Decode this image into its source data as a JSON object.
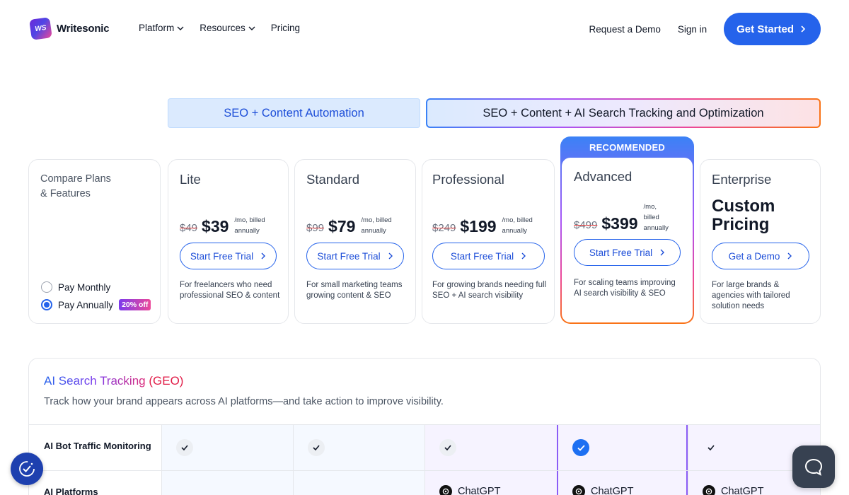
{
  "header": {
    "logo_mark": "WS",
    "logo_text": "Writesonic",
    "nav": [
      {
        "label": "Platform"
      },
      {
        "label": "Resources"
      },
      {
        "label": "Pricing"
      }
    ],
    "request_demo": "Request a Demo",
    "sign_in": "Sign in",
    "get_started": "Get Started"
  },
  "tabs": {
    "tab1": "SEO + Content Automation",
    "tab2": "SEO + Content + AI Search Tracking and Optimization"
  },
  "compare": {
    "title_line1": "Compare Plans",
    "title_line2": "& Features",
    "pay_monthly": "Pay Monthly",
    "pay_annually": "Pay Annually",
    "discount_badge": "20% off",
    "selected": "annually"
  },
  "plans": [
    {
      "name": "Lite",
      "old_price": "$49",
      "price": "$39",
      "per_line1": "/mo, billed",
      "per_line2": "annually",
      "cta": "Start Free Trial",
      "desc_line1": "For freelancers who need",
      "desc_line2": "professional SEO & content"
    },
    {
      "name": "Standard",
      "old_price": "$99",
      "price": "$79",
      "per_line1": "/mo, billed",
      "per_line2": "annually",
      "cta": "Start Free Trial",
      "desc_line1": "For small marketing teams",
      "desc_line2": "growing content & SEO"
    },
    {
      "name": "Professional",
      "old_price": "$249",
      "price": "$199",
      "per_line1": "/mo, billed",
      "per_line2": "annually",
      "cta": "Start Free Trial",
      "desc_line1": "For growing brands needing full",
      "desc_line2": "SEO + AI search visibility"
    },
    {
      "name": "Advanced",
      "badge": "RECOMMENDED",
      "old_price": "$499",
      "price": "$399",
      "per_line1": "/mo,",
      "per_line2": "billed",
      "per_line3": "annually",
      "cta": "Start Free Trial",
      "desc_line1": "For scaling teams improving",
      "desc_line2": "AI search visibility & SEO"
    },
    {
      "name": "Enterprise",
      "big_line1": "Custom",
      "big_line2": "Pricing",
      "cta": "Get a Demo",
      "desc_line1": "For large brands &",
      "desc_line2": "agencies with tailored",
      "desc_line3": "solution needs"
    }
  ],
  "geo": {
    "title_main": "AI Search Tracking",
    "title_tag": "(GEO)",
    "subtitle": "Track how your brand appears across AI platforms—and take action to improve visibility.",
    "rows": [
      {
        "label": "AI Bot Traffic Monitoring",
        "values": [
          "check",
          "check",
          "check",
          "check-blue",
          "check"
        ]
      },
      {
        "label": "AI Platforms",
        "values": [
          "",
          "",
          "ChatGPT",
          "ChatGPT",
          "ChatGPT"
        ]
      }
    ]
  },
  "colors": {
    "primary": "#2563eb",
    "accent_purple": "#8b5cf6",
    "accent_pink": "#ec4899",
    "accent_orange": "#f97316"
  },
  "icons": {
    "cookie": "cookie-settings-icon",
    "chat": "chat-bubble-icon"
  }
}
